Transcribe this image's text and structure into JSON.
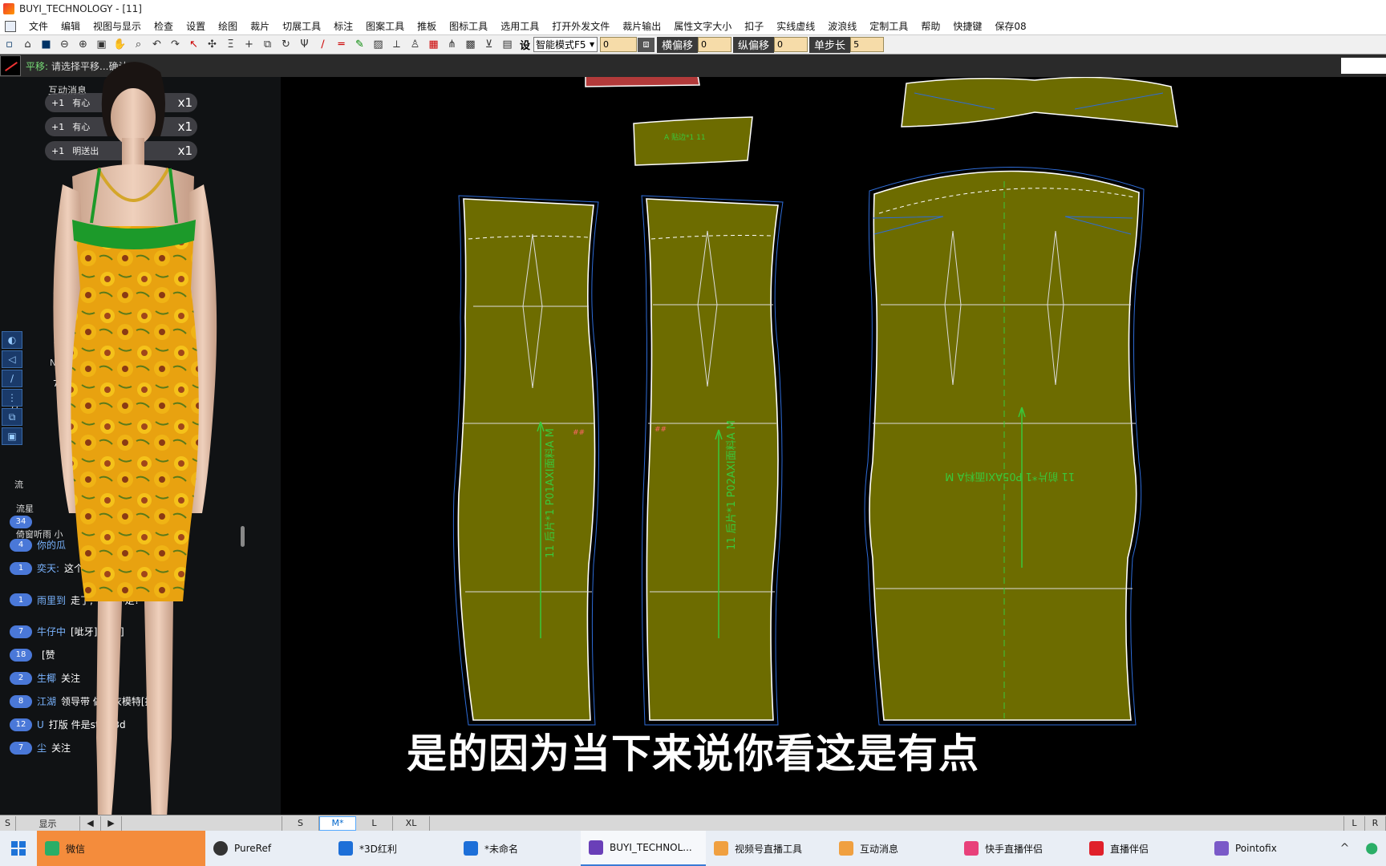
{
  "window": {
    "title": "BUYI_TECHNOLOGY - [11]"
  },
  "menu": [
    "文件",
    "编辑",
    "视图与显示",
    "检查",
    "设置",
    "绘图",
    "裁片",
    "切展工具",
    "标注",
    "图案工具",
    "推板",
    "图标工具",
    "选用工具",
    "打开外发文件",
    "裁片输出",
    "属性文字大小",
    "扣子",
    "实线虚线",
    "波浪线",
    "定制工具",
    "帮助",
    "快捷键",
    "保存08"
  ],
  "toolbar": {
    "set_label": "设",
    "mode_select": "智能模式F5",
    "field1": "0",
    "h_offset_label": "横偏移",
    "h_offset_value": "0",
    "v_offset_label": "纵偏移",
    "v_offset_value": "0",
    "step_label": "单步长",
    "step_value": "5",
    "icons": [
      "new-file-icon",
      "open-folder-icon",
      "save-icon",
      "zoom-out-icon",
      "zoom-in-icon",
      "fit-window-icon",
      "pan-hand-icon",
      "zoom-select-icon",
      "undo-icon",
      "redo-icon",
      "select-arrow-icon",
      "move-point-icon",
      "align-icon",
      "cross-icon",
      "mirror-icon",
      "rotate-icon",
      "fork-icon",
      "line-icon",
      "double-line-icon",
      "pencil-icon",
      "hatch-icon",
      "measure-icon",
      "stamp-icon",
      "color-grid-icon",
      "split-icon",
      "image-icon",
      "notch-icon",
      "pattern-icon"
    ]
  },
  "status": {
    "command": "平移:",
    "prompt": "请选择平移...确认..."
  },
  "chat": {
    "title": "互动消息",
    "gifts": [
      {
        "user": "有心",
        "count": "x1"
      },
      {
        "user": "有心",
        "count": "x1"
      },
      {
        "user": "明送出",
        "count": "x1"
      }
    ],
    "side_numbers": [
      "8",
      "8",
      "1",
      "7"
    ],
    "side_texts": [
      "Nit:",
      "互",
      "流",
      "流星",
      "倚窗听雨 小"
    ],
    "messages": [
      {
        "level": "34",
        "user": "",
        "text": ""
      },
      {
        "level": "4",
        "user": "你的瓜",
        "text": ""
      },
      {
        "level": "1",
        "user": "奕天:",
        "text": "这个"
      },
      {
        "level": "1",
        "user": "雨里到",
        "text": "走了, 衣服不走?"
      },
      {
        "level": "7",
        "user": "牛仔中",
        "text": "[呲牙][呲牙]"
      },
      {
        "level": "18",
        "user": "",
        "text": "[赞"
      },
      {
        "level": "2",
        "user": "生椰",
        "text": "关注"
      },
      {
        "level": "8",
        "user": "江湖",
        "text": "领导带 做试衣模特[捂脸]"
      },
      {
        "level": "12",
        "user": "U",
        "text": "打版 件是style3d"
      },
      {
        "level": "7",
        "user": "尘",
        "text": "关注"
      }
    ]
  },
  "pieces": {
    "back_left_label": "11 后片*1 P01AXI面料A M",
    "back_right_label": "11 后片*1 P02AXI面料A M",
    "front_label": "11 前片*1 P05AXI面料A M",
    "small_label": "A 贴边*1 11",
    "notch_marks": "##"
  },
  "subtitle": "是的因为当下来说你看这是有点",
  "sizes": [
    "S",
    "M*",
    "L",
    "XL"
  ],
  "size_left": "S",
  "size_show": "显示",
  "size_right": [
    "L",
    "R"
  ],
  "taskbar": {
    "items": [
      {
        "label": "微信",
        "icon_color": "#2aae67"
      },
      {
        "label": "PureRef",
        "icon_color": "#333333"
      },
      {
        "label": "*3D红利",
        "icon_color": "#1d6fd8"
      },
      {
        "label": "*未命名",
        "icon_color": "#1d6fd8"
      },
      {
        "label": "BUYI_TECHNOL...",
        "icon_color": "#6a3fb8"
      },
      {
        "label": "视频号直播工具",
        "icon_color": "#f0a040"
      },
      {
        "label": "互动消息",
        "icon_color": "#f0a040"
      },
      {
        "label": "快手直播伴侣",
        "icon_color": "#e8407a"
      },
      {
        "label": "直播伴侣",
        "icon_color": "#e0202a"
      },
      {
        "label": "Pointofix",
        "icon_color": "#7a5ac8"
      }
    ],
    "tray": [
      "^",
      "⬤"
    ]
  },
  "colors": {
    "piece_fill": "#6d6c00",
    "piece_stroke": "#ffffff",
    "seam_line": "#2e6cd8",
    "grain_line": "#3ac83a",
    "accent": "#3a7bd5"
  }
}
